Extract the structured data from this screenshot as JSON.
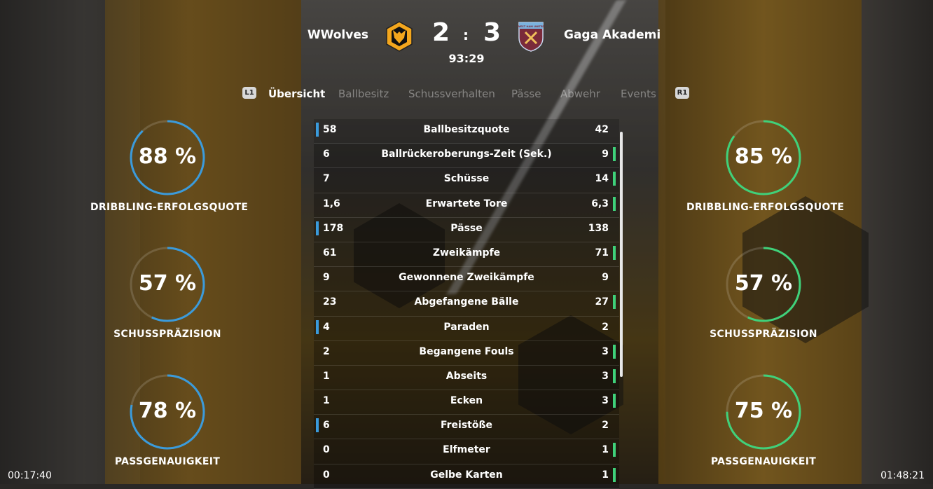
{
  "colors": {
    "home": "#3a9bdc",
    "away": "#3fd17a",
    "home_crest": "#f3a61d",
    "away_crest": "#7a2a3a"
  },
  "scoreboard": {
    "home_team": "WWolves",
    "away_team": "Gaga Akademi",
    "home_goals": "2",
    "away_goals": "3",
    "separator": ":",
    "match_clock": "93:29",
    "away_crest_text": "WEST HAM UNITED"
  },
  "tabs": {
    "left_key": "L1",
    "right_key": "R1",
    "items": [
      {
        "label": "Übersicht",
        "active": true
      },
      {
        "label": "Ballbesitz",
        "active": false
      },
      {
        "label": "Schussverhalten",
        "active": false
      },
      {
        "label": "Pässe",
        "active": false
      },
      {
        "label": "Abwehr",
        "active": false
      },
      {
        "label": "Events",
        "active": false
      }
    ]
  },
  "gauges_home": [
    {
      "value": 88,
      "text": "88 %",
      "label": "DRIBBLING-ERFOLGSQUOTE"
    },
    {
      "value": 57,
      "text": "57 %",
      "label": "SCHUSSPRÄZISION"
    },
    {
      "value": 78,
      "text": "78 %",
      "label": "PASSGENAUIGKEIT"
    }
  ],
  "gauges_away": [
    {
      "value": 85,
      "text": "85 %",
      "label": "DRIBBLING-ERFOLGSQUOTE"
    },
    {
      "value": 57,
      "text": "57 %",
      "label": "SCHUSSPRÄZISION"
    },
    {
      "value": 75,
      "text": "75 %",
      "label": "PASSGENAUIGKEIT"
    }
  ],
  "stats": [
    {
      "name": "Ballbesitzquote",
      "home": "58",
      "away": "42",
      "leader": "home"
    },
    {
      "name": "Ballrückeroberungs-Zeit (Sek.)",
      "home": "6",
      "away": "9",
      "leader": "away"
    },
    {
      "name": "Schüsse",
      "home": "7",
      "away": "14",
      "leader": "away"
    },
    {
      "name": "Erwartete Tore",
      "home": "1,6",
      "away": "6,3",
      "leader": "away"
    },
    {
      "name": "Pässe",
      "home": "178",
      "away": "138",
      "leader": "home"
    },
    {
      "name": "Zweikämpfe",
      "home": "61",
      "away": "71",
      "leader": "away"
    },
    {
      "name": "Gewonnene Zweikämpfe",
      "home": "9",
      "away": "9",
      "leader": "none"
    },
    {
      "name": "Abgefangene Bälle",
      "home": "23",
      "away": "27",
      "leader": "away"
    },
    {
      "name": "Paraden",
      "home": "4",
      "away": "2",
      "leader": "home"
    },
    {
      "name": "Begangene Fouls",
      "home": "2",
      "away": "3",
      "leader": "away"
    },
    {
      "name": "Abseits",
      "home": "1",
      "away": "3",
      "leader": "away"
    },
    {
      "name": "Ecken",
      "home": "1",
      "away": "3",
      "leader": "away"
    },
    {
      "name": "Freistöße",
      "home": "6",
      "away": "2",
      "leader": "home"
    },
    {
      "name": "Elfmeter",
      "home": "0",
      "away": "1",
      "leader": "away"
    },
    {
      "name": "Gelbe Karten",
      "home": "0",
      "away": "1",
      "leader": "away"
    }
  ],
  "timestamps": {
    "left": "00:17:40",
    "right": "01:48:21"
  }
}
